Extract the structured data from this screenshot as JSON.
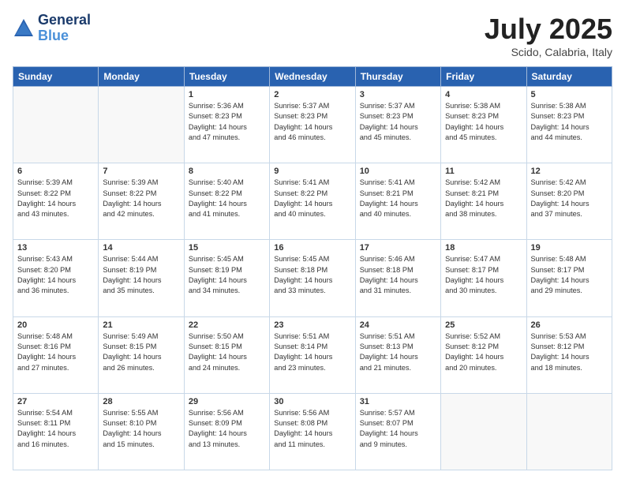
{
  "header": {
    "logo_line1": "General",
    "logo_line2": "Blue",
    "month": "July 2025",
    "location": "Scido, Calabria, Italy"
  },
  "weekdays": [
    "Sunday",
    "Monday",
    "Tuesday",
    "Wednesday",
    "Thursday",
    "Friday",
    "Saturday"
  ],
  "weeks": [
    [
      {
        "day": "",
        "info": ""
      },
      {
        "day": "",
        "info": ""
      },
      {
        "day": "1",
        "info": "Sunrise: 5:36 AM\nSunset: 8:23 PM\nDaylight: 14 hours\nand 47 minutes."
      },
      {
        "day": "2",
        "info": "Sunrise: 5:37 AM\nSunset: 8:23 PM\nDaylight: 14 hours\nand 46 minutes."
      },
      {
        "day": "3",
        "info": "Sunrise: 5:37 AM\nSunset: 8:23 PM\nDaylight: 14 hours\nand 45 minutes."
      },
      {
        "day": "4",
        "info": "Sunrise: 5:38 AM\nSunset: 8:23 PM\nDaylight: 14 hours\nand 45 minutes."
      },
      {
        "day": "5",
        "info": "Sunrise: 5:38 AM\nSunset: 8:23 PM\nDaylight: 14 hours\nand 44 minutes."
      }
    ],
    [
      {
        "day": "6",
        "info": "Sunrise: 5:39 AM\nSunset: 8:22 PM\nDaylight: 14 hours\nand 43 minutes."
      },
      {
        "day": "7",
        "info": "Sunrise: 5:39 AM\nSunset: 8:22 PM\nDaylight: 14 hours\nand 42 minutes."
      },
      {
        "day": "8",
        "info": "Sunrise: 5:40 AM\nSunset: 8:22 PM\nDaylight: 14 hours\nand 41 minutes."
      },
      {
        "day": "9",
        "info": "Sunrise: 5:41 AM\nSunset: 8:22 PM\nDaylight: 14 hours\nand 40 minutes."
      },
      {
        "day": "10",
        "info": "Sunrise: 5:41 AM\nSunset: 8:21 PM\nDaylight: 14 hours\nand 40 minutes."
      },
      {
        "day": "11",
        "info": "Sunrise: 5:42 AM\nSunset: 8:21 PM\nDaylight: 14 hours\nand 38 minutes."
      },
      {
        "day": "12",
        "info": "Sunrise: 5:42 AM\nSunset: 8:20 PM\nDaylight: 14 hours\nand 37 minutes."
      }
    ],
    [
      {
        "day": "13",
        "info": "Sunrise: 5:43 AM\nSunset: 8:20 PM\nDaylight: 14 hours\nand 36 minutes."
      },
      {
        "day": "14",
        "info": "Sunrise: 5:44 AM\nSunset: 8:19 PM\nDaylight: 14 hours\nand 35 minutes."
      },
      {
        "day": "15",
        "info": "Sunrise: 5:45 AM\nSunset: 8:19 PM\nDaylight: 14 hours\nand 34 minutes."
      },
      {
        "day": "16",
        "info": "Sunrise: 5:45 AM\nSunset: 8:18 PM\nDaylight: 14 hours\nand 33 minutes."
      },
      {
        "day": "17",
        "info": "Sunrise: 5:46 AM\nSunset: 8:18 PM\nDaylight: 14 hours\nand 31 minutes."
      },
      {
        "day": "18",
        "info": "Sunrise: 5:47 AM\nSunset: 8:17 PM\nDaylight: 14 hours\nand 30 minutes."
      },
      {
        "day": "19",
        "info": "Sunrise: 5:48 AM\nSunset: 8:17 PM\nDaylight: 14 hours\nand 29 minutes."
      }
    ],
    [
      {
        "day": "20",
        "info": "Sunrise: 5:48 AM\nSunset: 8:16 PM\nDaylight: 14 hours\nand 27 minutes."
      },
      {
        "day": "21",
        "info": "Sunrise: 5:49 AM\nSunset: 8:15 PM\nDaylight: 14 hours\nand 26 minutes."
      },
      {
        "day": "22",
        "info": "Sunrise: 5:50 AM\nSunset: 8:15 PM\nDaylight: 14 hours\nand 24 minutes."
      },
      {
        "day": "23",
        "info": "Sunrise: 5:51 AM\nSunset: 8:14 PM\nDaylight: 14 hours\nand 23 minutes."
      },
      {
        "day": "24",
        "info": "Sunrise: 5:51 AM\nSunset: 8:13 PM\nDaylight: 14 hours\nand 21 minutes."
      },
      {
        "day": "25",
        "info": "Sunrise: 5:52 AM\nSunset: 8:12 PM\nDaylight: 14 hours\nand 20 minutes."
      },
      {
        "day": "26",
        "info": "Sunrise: 5:53 AM\nSunset: 8:12 PM\nDaylight: 14 hours\nand 18 minutes."
      }
    ],
    [
      {
        "day": "27",
        "info": "Sunrise: 5:54 AM\nSunset: 8:11 PM\nDaylight: 14 hours\nand 16 minutes."
      },
      {
        "day": "28",
        "info": "Sunrise: 5:55 AM\nSunset: 8:10 PM\nDaylight: 14 hours\nand 15 minutes."
      },
      {
        "day": "29",
        "info": "Sunrise: 5:56 AM\nSunset: 8:09 PM\nDaylight: 14 hours\nand 13 minutes."
      },
      {
        "day": "30",
        "info": "Sunrise: 5:56 AM\nSunset: 8:08 PM\nDaylight: 14 hours\nand 11 minutes."
      },
      {
        "day": "31",
        "info": "Sunrise: 5:57 AM\nSunset: 8:07 PM\nDaylight: 14 hours\nand 9 minutes."
      },
      {
        "day": "",
        "info": ""
      },
      {
        "day": "",
        "info": ""
      }
    ]
  ]
}
